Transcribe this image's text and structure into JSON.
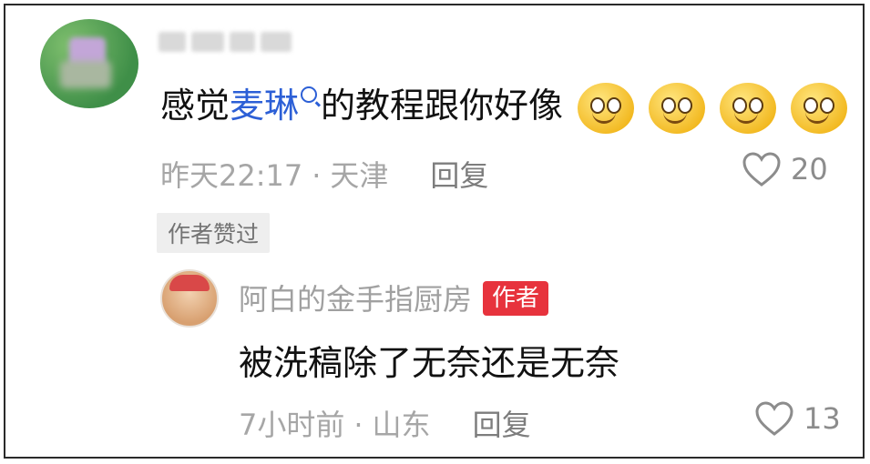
{
  "comment": {
    "text_prefix": "感觉",
    "mention": "麦琳",
    "text_suffix": "的教程跟你好像",
    "emoji_icon": "grinning-emoji",
    "time": "昨天22:17",
    "location": "天津",
    "reply_label": "回复",
    "like_count": "20",
    "liked_by_author_label": "作者赞过"
  },
  "reply": {
    "author_name": "阿白的金手指厨房",
    "author_badge": "作者",
    "text": "被洗稿除了无奈还是无奈",
    "time": "7小时前",
    "location": "山东",
    "reply_label": "回复",
    "like_count": "13"
  },
  "colors": {
    "mention": "#2c5fd6",
    "author_badge_bg": "#e7333d",
    "meta_text": "#a6a6a6"
  }
}
